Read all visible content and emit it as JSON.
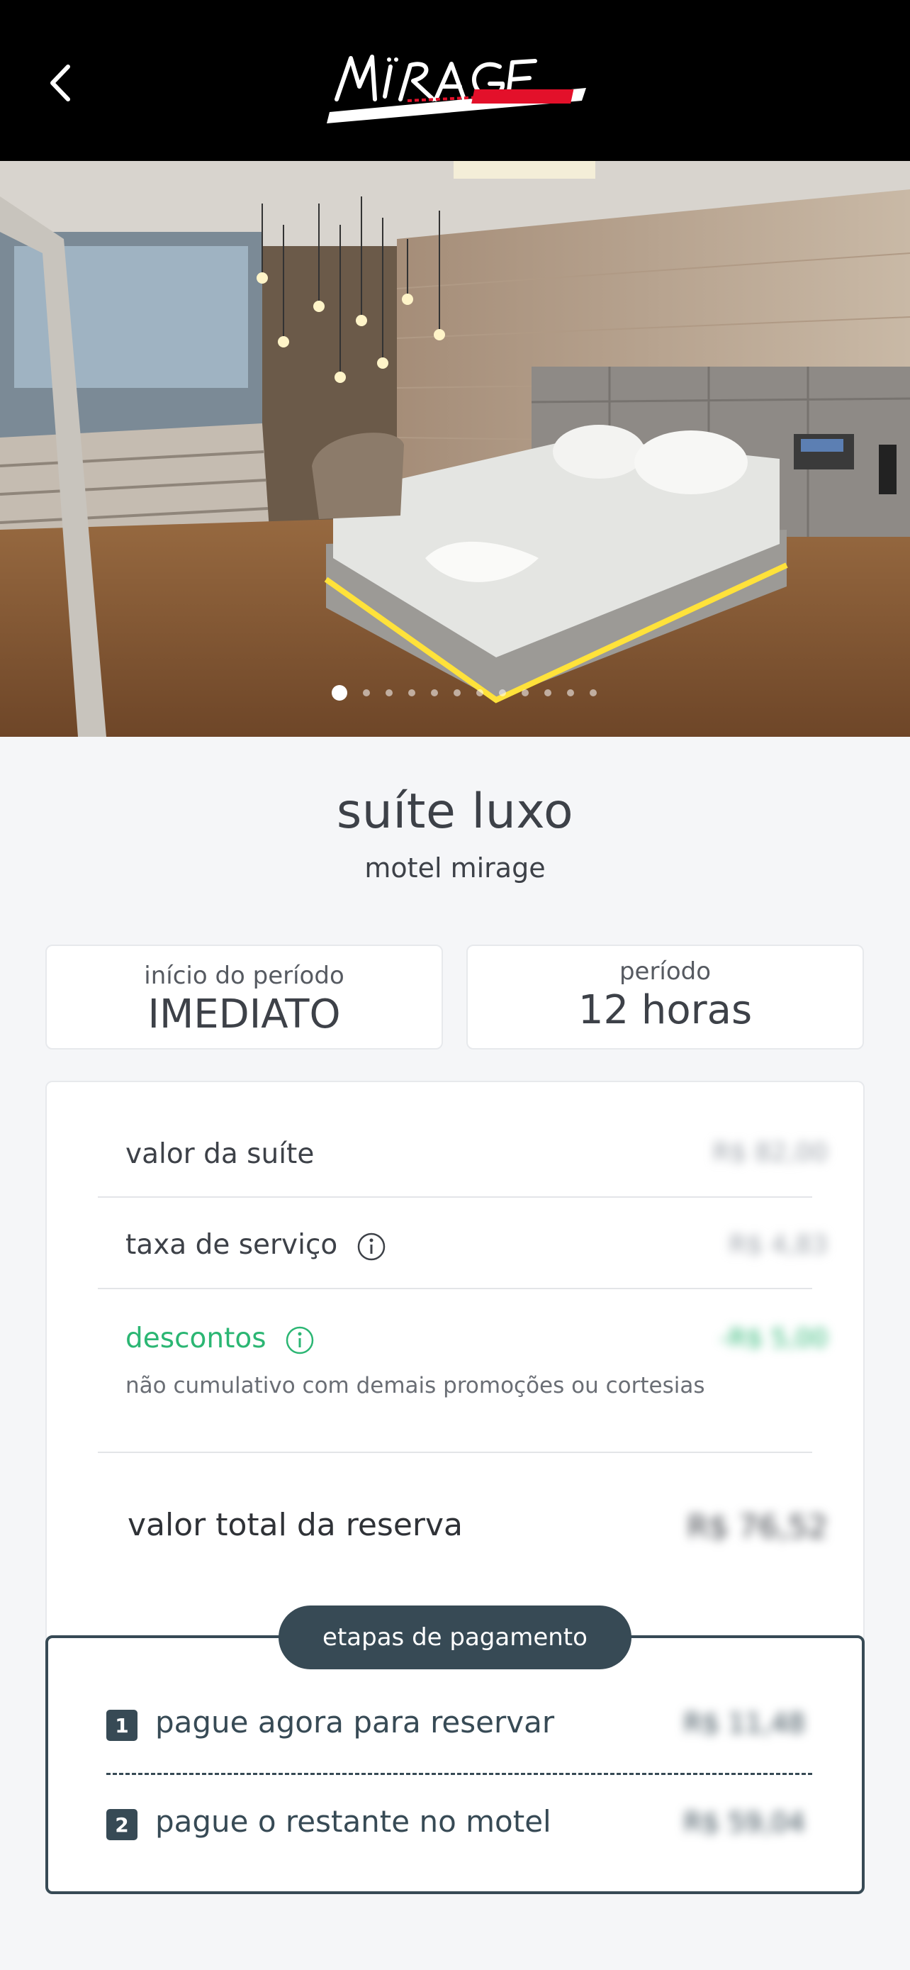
{
  "header": {
    "back_label": "voltar",
    "logo_text": "Mirage Motel"
  },
  "gallery": {
    "total_images": 12,
    "active_index": 0
  },
  "suite": {
    "name": "suíte luxo",
    "motel": "motel mirage"
  },
  "booking": {
    "start_label": "início do período",
    "start_value": "IMEDIATO",
    "period_label": "período",
    "period_value": "12 horas"
  },
  "pricing": {
    "suite_value_label": "valor da suíte",
    "suite_value": "R$ 82,00",
    "service_fee_label": "taxa de serviço",
    "service_fee": "R$ 4,83",
    "discounts_label": "descontos",
    "discounts_value": "-R$ 5,00",
    "discounts_note": "não cumulativo com demais promoções ou cortesias",
    "total_label": "valor total da reserva",
    "total_value": "R$ 76,52"
  },
  "payment_steps": {
    "title": "etapas de pagamento",
    "steps": [
      {
        "number": "1",
        "label": "pague agora para reservar",
        "value": "R$ 11,48"
      },
      {
        "number": "2",
        "label": "pague o restante no motel",
        "value": "R$ 59,04"
      }
    ]
  },
  "colors": {
    "accent": "#374a55",
    "discount_green": "#2bb673",
    "header_bg": "#000000",
    "page_bg": "#f5f6f8"
  }
}
